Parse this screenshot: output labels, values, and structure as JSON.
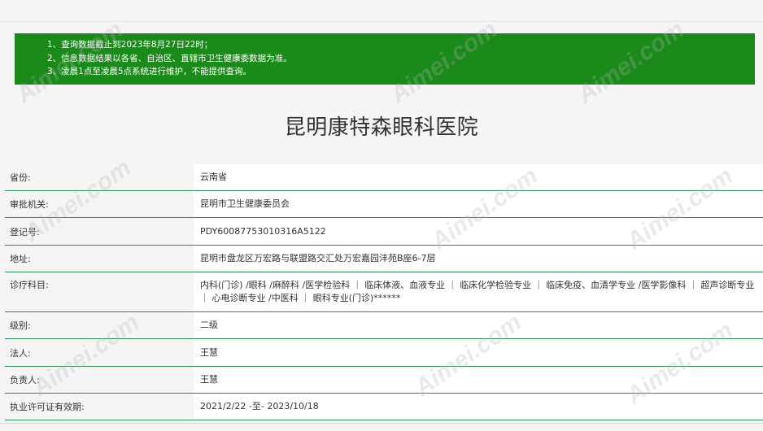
{
  "notice": [
    "1、查询数据截止到2023年8月27日22时；",
    "2、信息数据结果以各省、自治区、直辖市卫生健康委数据为准。",
    "3、凌晨1点至凌晨5点系统进行维护，不能提供查询。"
  ],
  "title": "昆明康特森眼科医院",
  "rows": [
    {
      "label": "省份:",
      "value": "云南省"
    },
    {
      "label": "审批机关:",
      "value": "昆明市卫生健康委员会"
    },
    {
      "label": "登记号:",
      "value": "PDY60087753010316A5122"
    },
    {
      "label": "地址:",
      "value": "昆明市盘龙区万宏路与联盟路交汇处万宏嘉园沣苑B座6-7层"
    },
    {
      "label": "诊疗科目:",
      "value": "内科(门诊) /眼科 /麻醉科 /医学检验科 ｜ 临床体液、血液专业 ｜ 临床化学检验专业 ｜ 临床免疫、血清学专业 /医学影像科 ｜ 超声诊断专业 ｜ 心电诊断专业 /中医科 ｜ 眼科专业(门诊)******"
    },
    {
      "label": "级别:",
      "value": "二级"
    },
    {
      "label": "法人:",
      "value": "王慧"
    },
    {
      "label": "负责人:",
      "value": "王慧"
    },
    {
      "label": "执业许可证有效期:",
      "value": "2021/2/22 -至- 2023/10/18"
    }
  ],
  "watermark": "Aimei.com",
  "colors": {
    "notice_bg": "#1a8a1a",
    "row_border": "#2e8b57"
  }
}
